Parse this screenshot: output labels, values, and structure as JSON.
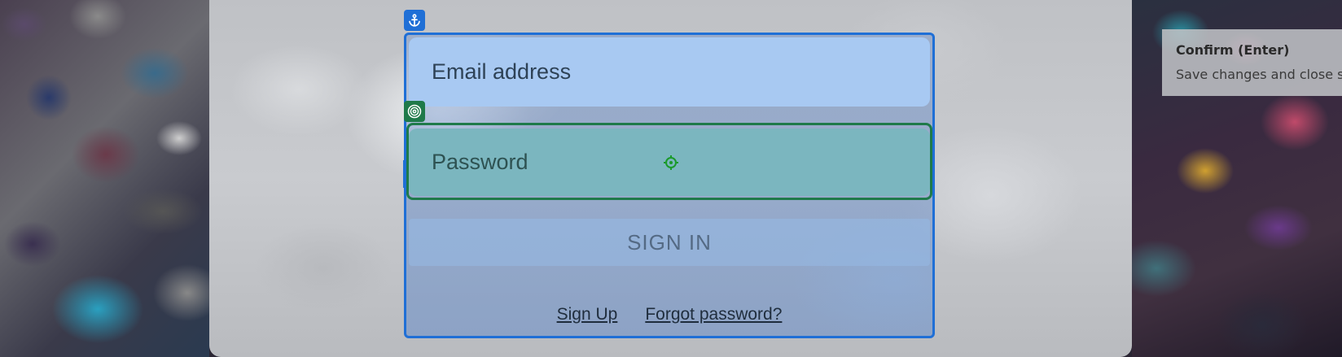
{
  "login": {
    "email_placeholder": "Email address",
    "password_placeholder": "Password",
    "signin_label": "SIGN IN",
    "signup_link": "Sign Up",
    "forgot_link": "Forgot password?"
  },
  "tooltip": {
    "title": "Confirm (Enter)",
    "description": "Save changes and close se"
  },
  "icons": {
    "anchor": "anchor-icon",
    "target": "target-icon",
    "crosshair": "crosshair-icon"
  },
  "colors": {
    "focus_blue": "#1f6fd6",
    "focus_green": "#1f7a4a",
    "email_bg": "#a8c9f2",
    "password_bg": "#7bb6bf"
  }
}
